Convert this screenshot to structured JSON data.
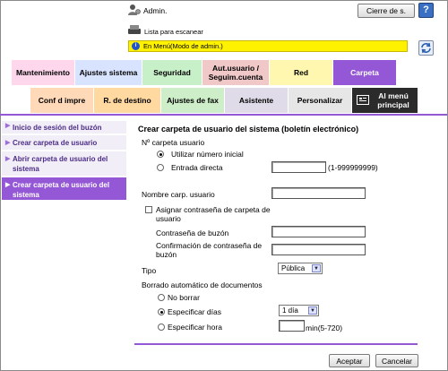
{
  "header": {
    "user_label": "Admin.",
    "logout_label": "Cierre de s.",
    "help_icon": "?",
    "scan_list_label": "Lista para escanear",
    "admin_mode_label": "En Menú(Modo de admin.)"
  },
  "tabs_row1": [
    {
      "label": "Mantenimiento",
      "color": "#ffd7ed"
    },
    {
      "label": "Ajustes sistema",
      "color": "#d7e3ff"
    },
    {
      "label": "Seguridad",
      "color": "#c8f0c8"
    },
    {
      "label": "Aut.usuario / Seguim.cuenta",
      "color": "#f0c8c8"
    },
    {
      "label": "Red",
      "color": "#fff7b0"
    },
    {
      "label": "Carpeta",
      "color": "#9457d6"
    }
  ],
  "tabs_row2": [
    {
      "label": "Conf d impre",
      "color": "#ffd9b8"
    },
    {
      "label": "R. de destino",
      "color": "#ffd9a0"
    },
    {
      "label": "Ajustes de fax",
      "color": "#cdeec8"
    },
    {
      "label": "Asistente",
      "color": "#e0dbe8"
    },
    {
      "label": "Personalizar",
      "color": "#e6e6e6"
    },
    {
      "label": "Al menú principal",
      "color": "#2b2b2b"
    }
  ],
  "sidebar": {
    "items": [
      {
        "label": "Inicio de sesión del buzón"
      },
      {
        "label": "Crear carpeta de usuario"
      },
      {
        "label": "Abrir carpeta de usuario del sistema"
      },
      {
        "label": "Crear carpeta de usuario del sistema"
      }
    ]
  },
  "form": {
    "title": "Crear carpeta de usuario del sistema (boletín electrónico)",
    "folder_no_label": "Nº carpeta usuario",
    "use_initial_label": "Utilizar número inicial",
    "direct_entry_label": "Entrada directa",
    "direct_entry_value": "",
    "direct_entry_range": "(1-999999999)",
    "folder_name_label": "Nombre carp. usuario",
    "folder_name_value": "",
    "assign_password_label": "Asignar contraseña de carpeta de usuario",
    "password_label": "Contraseña de buzón",
    "password_confirm_label": "Confirmación de contraseña de buzón",
    "type_label": "Tipo",
    "type_value": "Pública",
    "auto_delete_label": "Borrado automático de documentos",
    "no_delete_label": "No borrar",
    "specify_days_label": "Especificar días",
    "days_value": "1 día",
    "specify_hour_label": "Especificar hora",
    "hour_value": "",
    "hour_range": "min(5-720)",
    "accept_label": "Aceptar",
    "cancel_label": "Cancelar"
  }
}
